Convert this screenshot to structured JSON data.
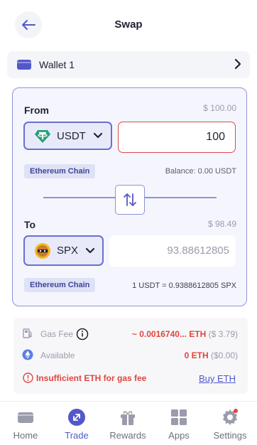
{
  "header": {
    "title": "Swap"
  },
  "wallet": {
    "label": "Wallet 1"
  },
  "from": {
    "label": "From",
    "usd_value": "$ 100.00",
    "token": "USDT",
    "amount": "100",
    "chain": "Ethereum Chain",
    "balance": "Balance: 0.00 USDT"
  },
  "to": {
    "label": "To",
    "usd_value": "$ 98.49",
    "token": "SPX",
    "amount": "93.88612805",
    "chain": "Ethereum Chain",
    "rate": "1 USDT = 0.9388612805 SPX"
  },
  "fees": {
    "gas_label": "Gas Fee",
    "gas_value": "~ 0.0016740... ETH",
    "gas_usd": "($ 3.79)",
    "available_label": "Available",
    "available_value": "0 ETH",
    "available_usd": "($0.00)",
    "warning": "Insufficient ETH for gas fee",
    "buy_link": "Buy ETH"
  },
  "nav": {
    "items": [
      {
        "label": "Home",
        "icon": "wallet-icon"
      },
      {
        "label": "Trade",
        "icon": "swap-icon",
        "active": true
      },
      {
        "label": "Rewards",
        "icon": "gift-icon"
      },
      {
        "label": "Apps",
        "icon": "grid-icon"
      },
      {
        "label": "Settings",
        "icon": "gear-icon"
      }
    ]
  },
  "colors": {
    "accent": "#5358c9",
    "error": "#e0463b",
    "card_border": "#8f92d8",
    "usdt_green": "#26a17b"
  }
}
